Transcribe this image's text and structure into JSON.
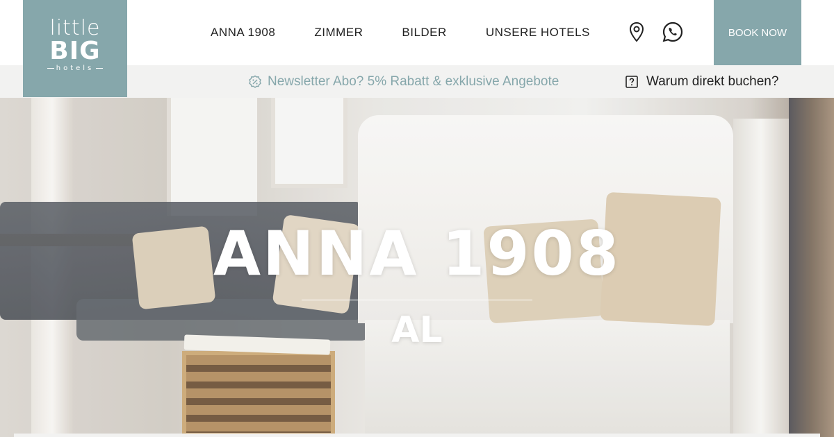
{
  "logo": {
    "line1": "little",
    "line2": "BIG",
    "line3": "hotels"
  },
  "nav": {
    "items": [
      {
        "label": "ANNA 1908"
      },
      {
        "label": "ZIMMER"
      },
      {
        "label": "BILDER"
      },
      {
        "label": "UNSERE HOTELS"
      }
    ]
  },
  "icons": {
    "location": "map-pin-icon",
    "whatsapp": "whatsapp-icon",
    "discount": "percent-badge-icon",
    "question": "question-square-icon"
  },
  "book_label": "BOOK NOW",
  "infobar": {
    "newsletter": "Newsletter Abo? 5% Rabatt & exklusive Angebote",
    "why_direct": "Warum direkt buchen?"
  },
  "hero": {
    "title": "ANNA 1908",
    "subtitle": "AL"
  },
  "colors": {
    "brand": "#86a7ab",
    "infobar_bg": "#f2f2f1",
    "text": "#222222"
  }
}
